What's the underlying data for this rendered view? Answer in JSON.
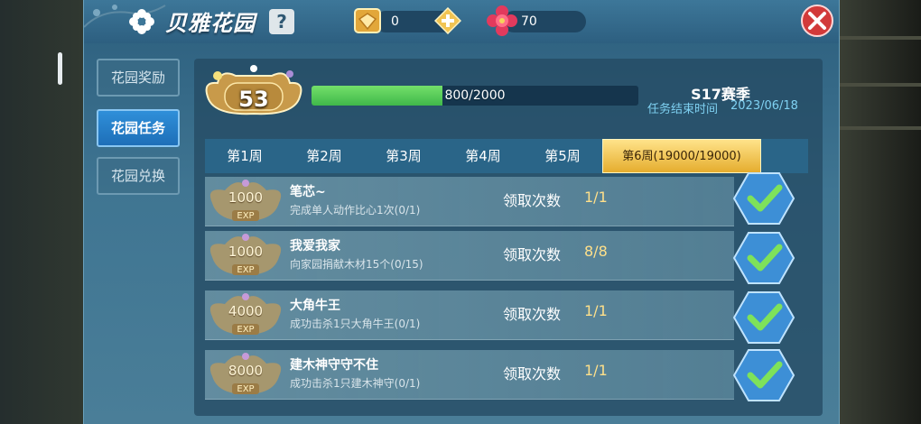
{
  "header": {
    "title": "贝雅花园",
    "help_label": "?",
    "gem_count": "0",
    "flower_count": "70"
  },
  "sidebar": {
    "items": [
      {
        "label": "花园奖励",
        "active": false
      },
      {
        "label": "花园任务",
        "active": true
      },
      {
        "label": "花园兑换",
        "active": false
      }
    ]
  },
  "level": {
    "number": "53",
    "xp_text": "800/2000",
    "progress": 0.4
  },
  "season": {
    "name": "S17赛季",
    "end_label": "任务结束时间",
    "end_date": "2023/06/18"
  },
  "weeks": [
    {
      "label": "第1周",
      "active": false
    },
    {
      "label": "第2周",
      "active": false
    },
    {
      "label": "第3周",
      "active": false
    },
    {
      "label": "第4周",
      "active": false
    },
    {
      "label": "第5周",
      "active": false
    },
    {
      "label": "第6周(19000/19000)",
      "active": true
    }
  ],
  "tasks": [
    {
      "exp": "1000",
      "name": "笔芯~",
      "desc": "完成单人动作比心1次(0/1)",
      "claim_label": "领取次数",
      "claim_value": "1/1"
    },
    {
      "exp": "1000",
      "name": "我爱我家",
      "desc": "向家园捐献木材15个(0/15)",
      "claim_label": "领取次数",
      "claim_value": "8/8"
    },
    {
      "exp": "4000",
      "name": "大角牛王",
      "desc": "成功击杀1只大角牛王(0/1)",
      "claim_label": "领取次数",
      "claim_value": "1/1"
    },
    {
      "exp": "8000",
      "name": "建木神守守不住",
      "desc": "成功击杀1只建木神守(0/1)",
      "claim_label": "领取次数",
      "claim_value": "1/1"
    }
  ],
  "exp_label": "EXP",
  "icons": [
    "flower-icon",
    "help-icon",
    "gem-icon",
    "plus-icon",
    "rose-icon",
    "close-icon",
    "level-badge-icon",
    "exp-badge-icon",
    "check-icon"
  ],
  "colors": {
    "panel": "#3f7592",
    "active_tab": "#1e6fb8",
    "week_active": "#e5ad2e",
    "xp_fill": "#3fb84a",
    "check": "#3d8fd6",
    "close": "#d23a3a"
  }
}
